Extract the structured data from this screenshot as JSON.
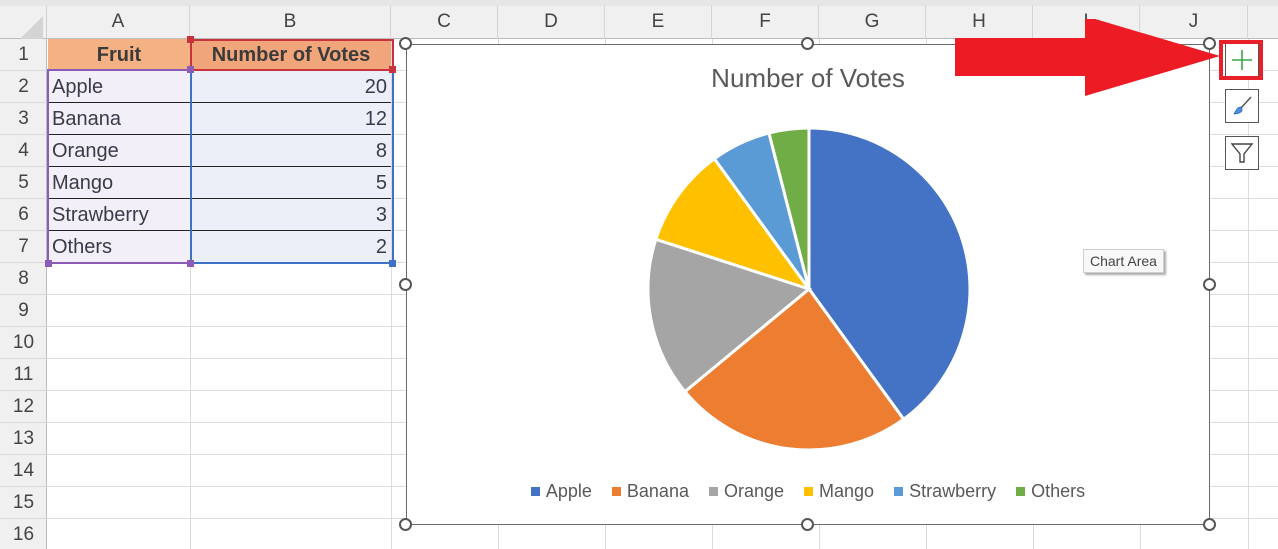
{
  "spreadsheet": {
    "columns": [
      "A",
      "B",
      "C",
      "D",
      "E",
      "F",
      "G",
      "H",
      "I",
      "J"
    ],
    "rows": [
      "1",
      "2",
      "3",
      "4",
      "5",
      "6",
      "7",
      "8",
      "9",
      "10",
      "11",
      "12",
      "13",
      "14",
      "15",
      "16"
    ],
    "table": {
      "headers": [
        "Fruit",
        "Number of Votes"
      ],
      "data": [
        {
          "fruit": "Apple",
          "votes": "20"
        },
        {
          "fruit": "Banana",
          "votes": "12"
        },
        {
          "fruit": "Orange",
          "votes": "8"
        },
        {
          "fruit": "Mango",
          "votes": "5"
        },
        {
          "fruit": "Strawberry",
          "votes": "3"
        },
        {
          "fruit": "Others",
          "votes": "2"
        }
      ]
    },
    "header_fill": "#f4b183"
  },
  "chart_data": {
    "type": "pie",
    "title": "Number of Votes",
    "categories": [
      "Apple",
      "Banana",
      "Orange",
      "Mango",
      "Strawberry",
      "Others"
    ],
    "values": [
      20,
      12,
      8,
      5,
      3,
      2
    ],
    "colors": [
      "#4472c4",
      "#ed7d31",
      "#a5a5a5",
      "#ffc000",
      "#5b9bd5",
      "#70ad47"
    ],
    "legend": "bottom",
    "start_angle": "12 o'clock, clockwise"
  },
  "chart_tools": {
    "elements_button": {
      "icon": "plus-icon",
      "color": "#3aa648"
    },
    "styles_button": {
      "icon": "paintbrush-icon"
    },
    "filters_button": {
      "icon": "funnel-icon"
    }
  },
  "tooltip": {
    "text": "Chart Area"
  },
  "annotation": {
    "arrow_color": "#ed1c24",
    "highlight_color": "#e8202a"
  }
}
